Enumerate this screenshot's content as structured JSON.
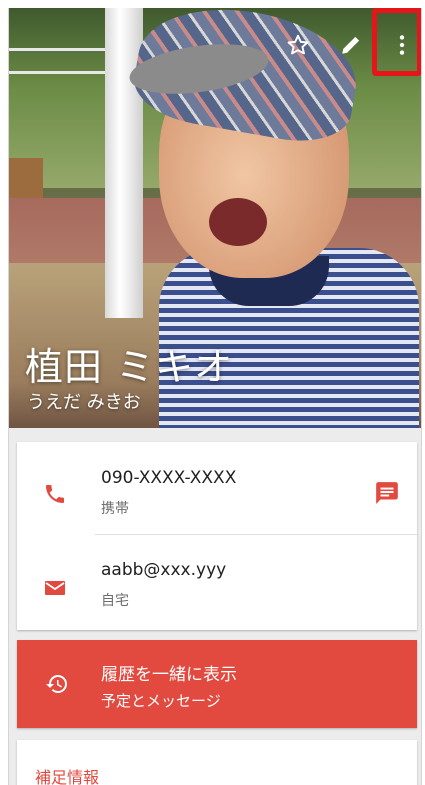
{
  "header": {
    "name": "植田 ミキオ",
    "reading": "うえだ みきお",
    "icons": [
      "star-outline-icon",
      "edit-pencil-icon",
      "more-vert-icon"
    ],
    "highlight_color": "#e5151a"
  },
  "contact": {
    "phone": {
      "number": "090-XXXX-XXXX",
      "type": "携帯",
      "icon": "phone-icon",
      "action_icon": "message-icon"
    },
    "email": {
      "address": "aabb@xxx.yyy",
      "type": "自宅",
      "icon": "email-icon"
    }
  },
  "history": {
    "title": "履歴を一緒に表示",
    "subtitle": "予定とメッセージ",
    "icon": "history-icon"
  },
  "extra": {
    "title": "補足情報"
  },
  "colors": {
    "accent": "#e2493f",
    "text_primary": "#212121",
    "text_secondary": "#6e6e6e"
  }
}
